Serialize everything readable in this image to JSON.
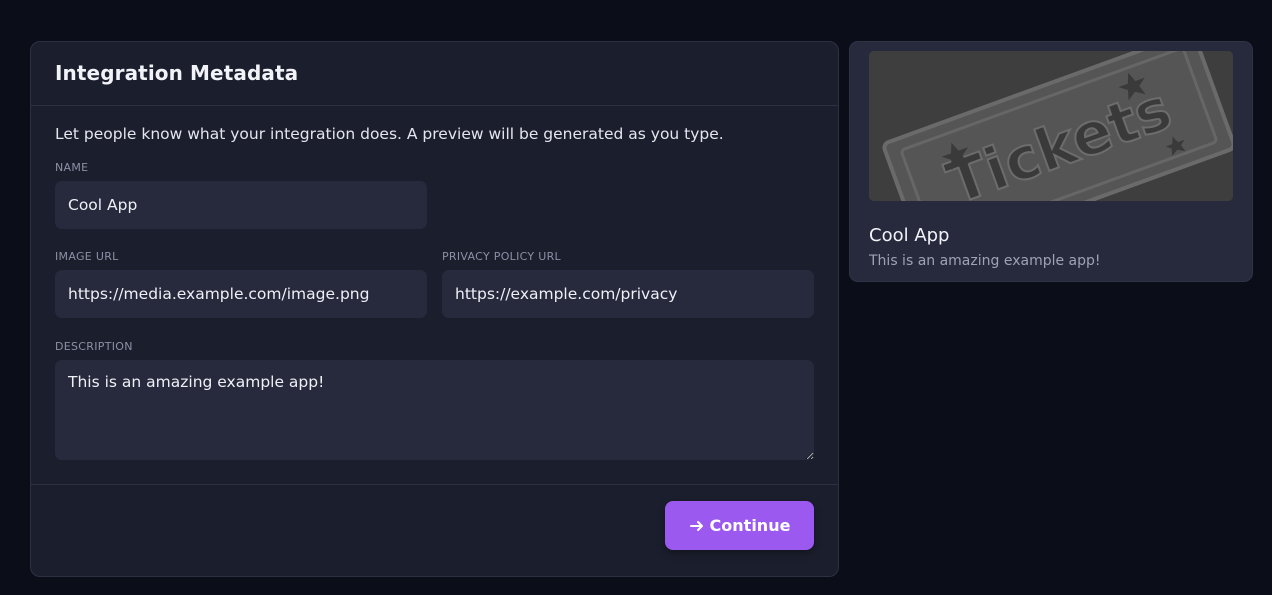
{
  "form": {
    "title": "Integration Metadata",
    "intro": "Let people know what your integration does. A preview will be generated as you type.",
    "name": {
      "label": "NAME",
      "value": "Cool App"
    },
    "image_url": {
      "label": "IMAGE URL",
      "value": "https://media.example.com/image.png"
    },
    "privacy_url": {
      "label": "PRIVACY POLICY URL",
      "value": "https://example.com/privacy"
    },
    "description": {
      "label": "DESCRIPTION",
      "value": "This is an amazing example app!"
    },
    "continue_label": "Continue"
  },
  "preview": {
    "image_text": "Tickets",
    "title": "Cool App",
    "description": "This is an amazing example app!"
  },
  "colors": {
    "background": "#0b0e19",
    "card": "#1b1e2d",
    "input": "#262a3c",
    "accent": "#9b59f0"
  },
  "icons": {
    "continue": "arrow-right-icon",
    "resize": "resize-handle-icon"
  }
}
